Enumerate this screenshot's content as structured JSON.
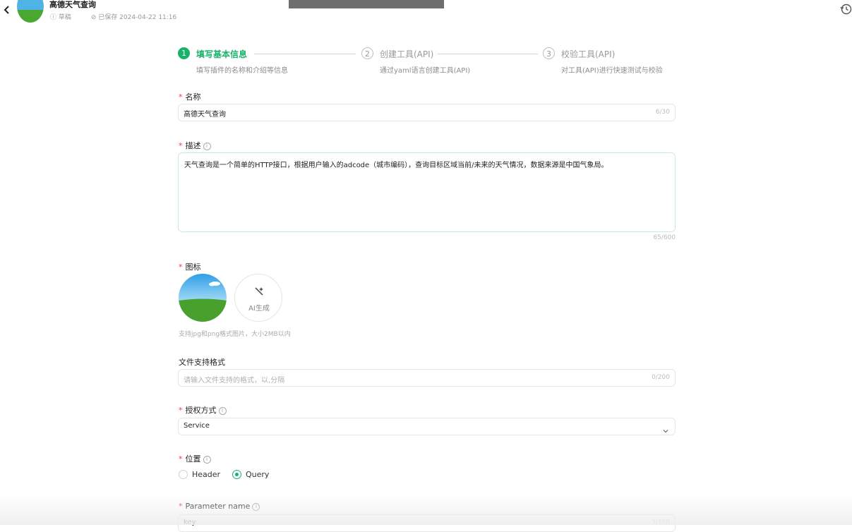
{
  "header": {
    "title": "高德天气查询",
    "status": "草稿",
    "saved": "已保存 2024-04-22 11:16"
  },
  "steps": [
    {
      "num": "1",
      "title": "填写基本信息",
      "desc": "填写插件的名称和介绍等信息"
    },
    {
      "num": "2",
      "title": "创建工具(API)",
      "desc": "通过yaml语言创建工具(API)"
    },
    {
      "num": "3",
      "title": "校验工具(API)",
      "desc": "对工具(API)进行快速测试与校验"
    }
  ],
  "form": {
    "name": {
      "label": "名称",
      "value": "高德天气查询",
      "count": "6/30"
    },
    "description": {
      "label": "描述",
      "value": "天气查询是一个简单的HTTP接口，根据用户输入的adcode（城市编码），查询目标区域当前/未来的天气情况，数据来源是中国气象局。",
      "count": "65/600"
    },
    "icon": {
      "label": "图标",
      "ai_label": "AI生成",
      "hint": "支持jpg和png格式图片，大小2MB以内"
    },
    "file_format": {
      "label": "文件支持格式",
      "placeholder": "请输入文件支持的格式，以,分隔",
      "count": "0/200"
    },
    "auth": {
      "label": "授权方式",
      "value": "Service"
    },
    "location": {
      "label": "位置",
      "options": [
        "Header",
        "Query"
      ],
      "selected": "Query"
    },
    "param_name": {
      "label": "Parameter name",
      "value": "key",
      "count": "3/100"
    }
  },
  "colors": {
    "accent": "#19b26b",
    "required": "#f23c3c"
  }
}
